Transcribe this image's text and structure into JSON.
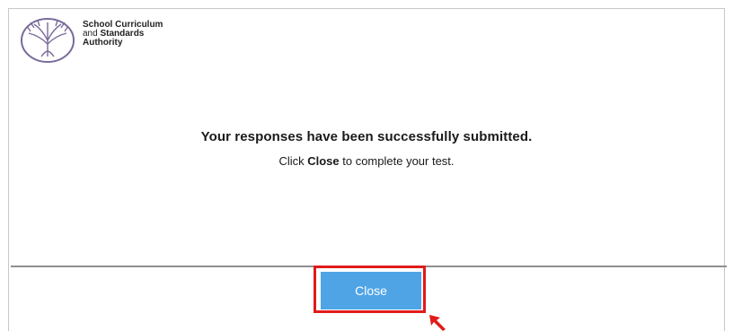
{
  "header": {
    "logo_icon": "tree-logo-icon",
    "org_line1": "School Curriculum",
    "org_line2_prefix": "and ",
    "org_line2_bold": "Standards",
    "org_line3": "Authority"
  },
  "message": {
    "title": "Your responses have been successfully submitted.",
    "instruction_prefix": "Click ",
    "instruction_emphasis": "Close",
    "instruction_suffix": " to complete your test."
  },
  "footer": {
    "close_label": "Close"
  },
  "annotation": {
    "highlight_color": "#e01b1b",
    "cursor_icon": "red-arrow-cursor-icon"
  },
  "colors": {
    "button": "#4fa4e6",
    "divider": "#8f8f8f"
  }
}
